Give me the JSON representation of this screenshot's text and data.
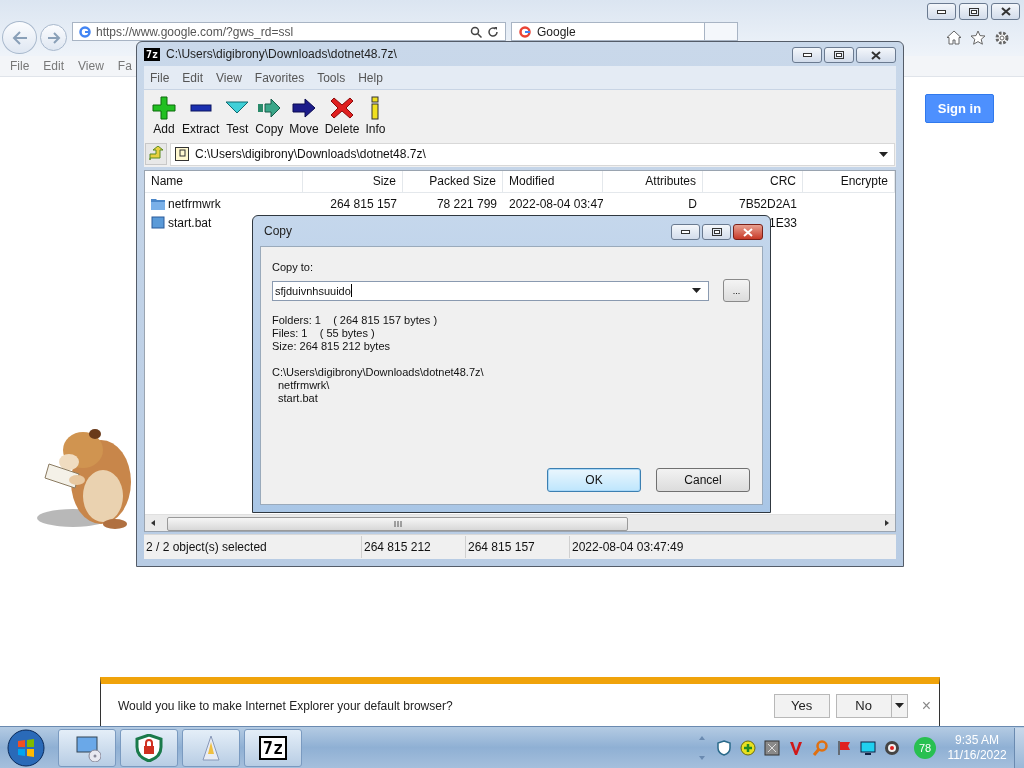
{
  "browser": {
    "address": "https://www.google.com/?gws_rd=ssl",
    "tab": "Google",
    "menu": [
      "File",
      "Edit",
      "View",
      "Fa"
    ],
    "sign_in": "Sign in"
  },
  "archive_window": {
    "logo": "7z",
    "title": "C:\\Users\\digibrony\\Downloads\\dotnet48.7z\\",
    "menu": [
      "File",
      "Edit",
      "View",
      "Favorites",
      "Tools",
      "Help"
    ],
    "toolbar": [
      {
        "kind": "add",
        "label": "Add"
      },
      {
        "kind": "extract",
        "label": "Extract"
      },
      {
        "kind": "test",
        "label": "Test"
      },
      {
        "kind": "copy",
        "label": "Copy"
      },
      {
        "kind": "move",
        "label": "Move"
      },
      {
        "kind": "delete",
        "label": "Delete"
      },
      {
        "kind": "info",
        "label": "Info"
      }
    ],
    "path": "C:\\Users\\digibrony\\Downloads\\dotnet48.7z\\",
    "columns": [
      "Name",
      "Size",
      "Packed Size",
      "Modified",
      "Attributes",
      "CRC",
      "Encrypte"
    ],
    "rows": [
      {
        "kind": "folder",
        "name": "netfrmwrk",
        "size": "264 815 157",
        "packed": "78 221 799",
        "modified": "2022-08-04 03:47",
        "attributes": "D",
        "crc": "7B52D2A1"
      },
      {
        "kind": "file",
        "name": "start.bat",
        "crc": "1E33"
      }
    ],
    "status": [
      "2 / 2 object(s) selected",
      "264 815 212",
      "264 815 157",
      "2022-08-04 03:47:49"
    ]
  },
  "copy_dialog": {
    "title": "Copy",
    "label": "Copy to:",
    "value": "sfjduivnhsuuido",
    "browse": "...",
    "info": [
      "Folders: 1    ( 264 815 157 bytes )",
      "Files: 1    ( 55 bytes )",
      "Size: 264 815 212 bytes"
    ],
    "paths": [
      "C:\\Users\\digibrony\\Downloads\\dotnet48.7z\\",
      "netfrmwrk\\",
      "start.bat"
    ],
    "buttons": [
      {
        "label": "OK",
        "default": true
      },
      {
        "label": "Cancel",
        "default": false
      }
    ]
  },
  "notification": {
    "text": "Would you like to make Internet Explorer your default browser?",
    "yes": "Yes",
    "no": "No",
    "close": "×"
  },
  "taskbar": {
    "apps": [
      {
        "kind": "computer"
      },
      {
        "kind": "shield"
      },
      {
        "kind": "cone"
      },
      {
        "kind": "sevenzip",
        "label": "7z"
      }
    ],
    "tray": [
      {
        "kind": "shield"
      },
      {
        "kind": "plus"
      },
      {
        "kind": "square"
      },
      {
        "kind": "chevron"
      },
      {
        "kind": "magnifier"
      },
      {
        "kind": "flag"
      },
      {
        "kind": "monitor"
      },
      {
        "kind": "speaker"
      }
    ],
    "badge": "78",
    "time": "9:35 AM",
    "date": "11/16/2022"
  }
}
